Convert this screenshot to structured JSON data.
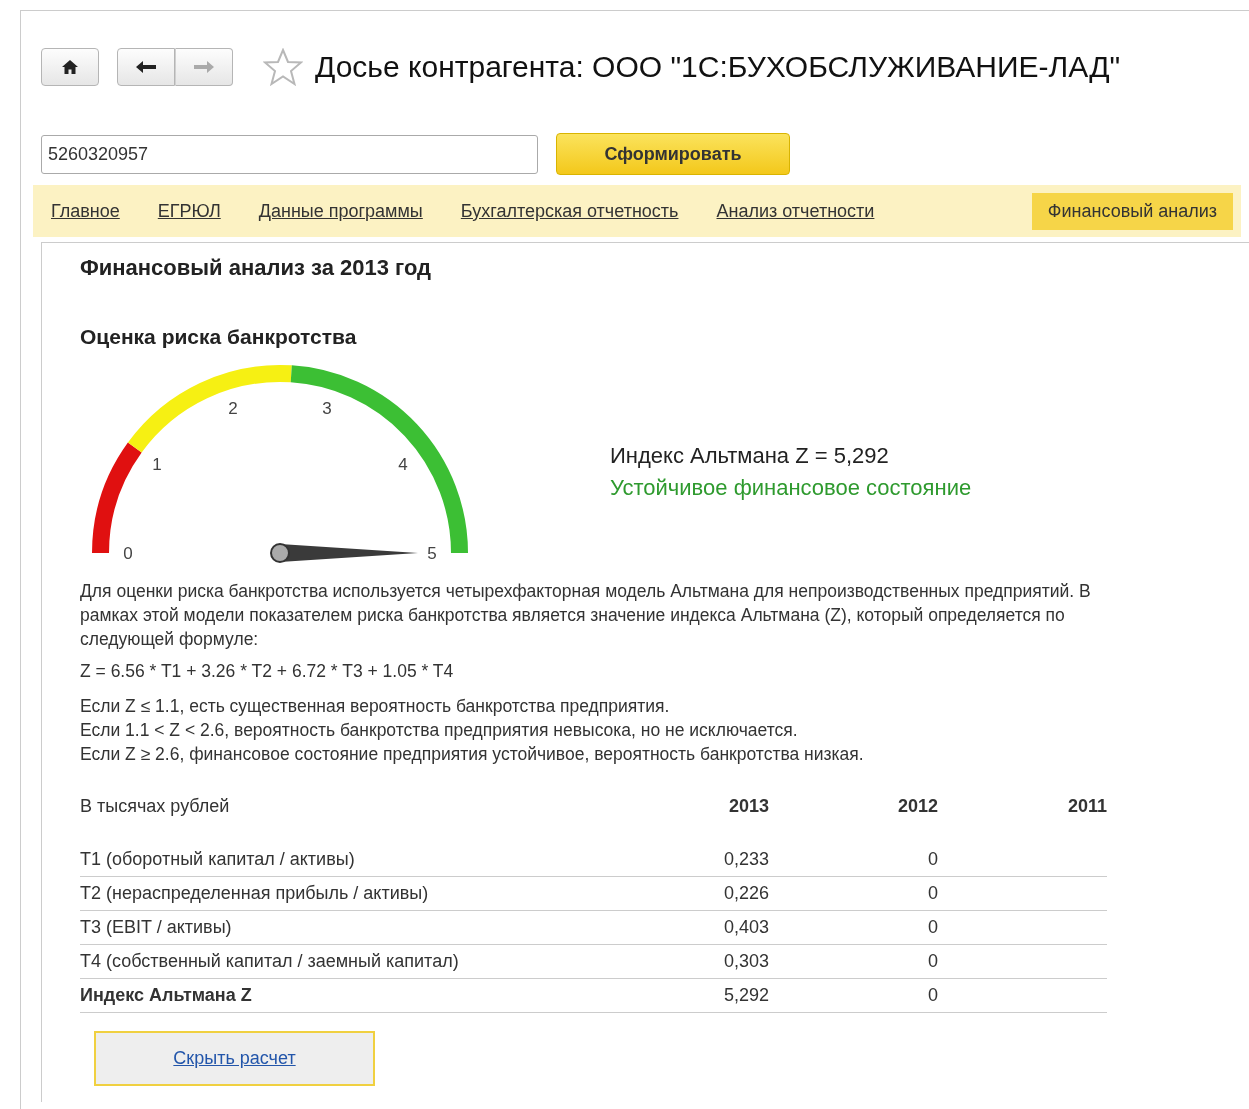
{
  "header": {
    "title": "Досье контрагента: ООО \"1С:БУХОБСЛУЖИВАНИЕ-ЛАД\""
  },
  "search": {
    "value": "5260320957"
  },
  "generate_button": "Сформировать",
  "tabs": [
    {
      "label": "Главное",
      "selected": false
    },
    {
      "label": "ЕГРЮЛ",
      "selected": false
    },
    {
      "label": "Данные программы",
      "selected": false
    },
    {
      "label": "Бухгалтерская отчетность",
      "selected": false
    },
    {
      "label": "Анализ отчетности",
      "selected": false
    },
    {
      "label": "Финансовый анализ",
      "selected": true
    }
  ],
  "heading": "Финансовый анализ за 2013 год",
  "subheading": "Оценка риска банкротства",
  "gauge": {
    "ticks": [
      "0",
      "1",
      "2",
      "3",
      "4",
      "5"
    ]
  },
  "result": {
    "index": "Индекс Альтмана Z = 5,292",
    "status": "Устойчивое финансовое состояние"
  },
  "description": "Для оценки риска банкротства используется четырехфакторная модель Альтмана для непроизводственных предприятий. В рамках этой модели показателем риска банкротства является значение индекса Альтмана (Z), который определяется по следующей формуле:",
  "formula": "Z = 6.56 * T1 + 3.26 * T2 + 6.72 * T3 + 1.05 * T4",
  "rules": [
    "Если Z ≤ 1.1, есть существенная вероятность банкротства предприятия.",
    "Если 1.1 < Z < 2.6, вероятность банкротства предприятия невысока, но не исключается.",
    "Если Z ≥ 2.6, финансовое состояние предприятия устойчивое, вероятность банкротства низкая."
  ],
  "table": {
    "columns": [
      "В тысячах рублей",
      "2013",
      "2012",
      "2011"
    ],
    "rows": [
      {
        "cells": [
          "Т1 (оборотный капитал / активы)",
          "0,233",
          "0"
        ],
        "kind": "normal"
      },
      {
        "cells": [
          "Т2 (нераспределенная прибыль / активы)",
          "0,226",
          "0"
        ],
        "kind": "normal"
      },
      {
        "cells": [
          "Т3 (EBIT / активы)",
          "0,403",
          "0"
        ],
        "kind": "normal"
      },
      {
        "cells": [
          "Т4 (собственный капитал / заемный капитал)",
          "0,303",
          "0"
        ],
        "kind": "normal"
      },
      {
        "cells": [
          "Индекс Альтмана Z",
          "5,292",
          "0"
        ],
        "kind": "total"
      }
    ]
  },
  "hide_button": "Скрыть расчет"
}
